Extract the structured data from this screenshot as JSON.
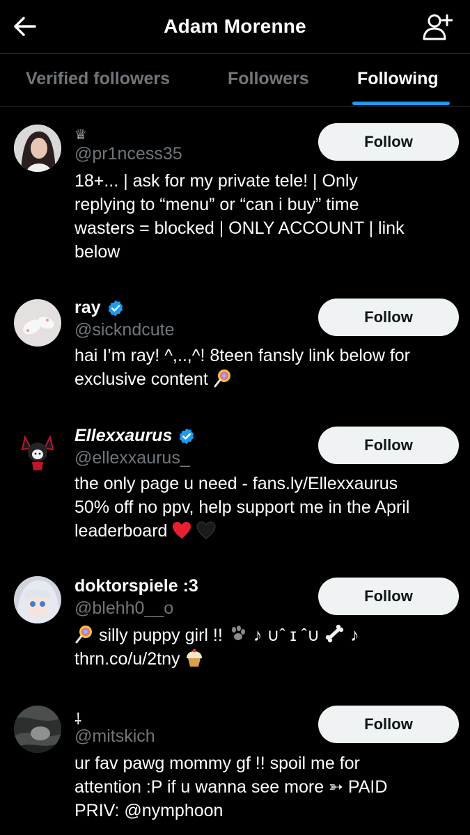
{
  "header": {
    "title": "Adam Morenne",
    "back_icon": "arrow-left-icon",
    "add_icon": "person-add-icon"
  },
  "tabs": [
    {
      "label": "Verified followers",
      "active": false
    },
    {
      "label": "Followers",
      "active": false
    },
    {
      "label": "Following",
      "active": true
    }
  ],
  "colors": {
    "background": "#000000",
    "accent": "#1d9bf0",
    "secondary_text": "#71767b",
    "button_bg": "#eff3f4"
  },
  "users": [
    {
      "name": "♕",
      "handle": "@pr1ncess35",
      "verified": false,
      "follow_label": "Follow",
      "bio_lines": [
        "18+... | ask for my private tele! | Only",
        "replying to “menu” or “can i buy” time",
        "wasters = blocked | ONLY ACCOUNT | link",
        "below"
      ]
    },
    {
      "name": "ray",
      "handle": "@sickndcute",
      "verified": true,
      "follow_label": "Follow",
      "bio_lines": [
        "hai I’m ray! ^,..,^! 8teen fansly link below for",
        "exclusive content"
      ]
    },
    {
      "name": "Ellexxaurus",
      "handle": "@ellexxaurus_",
      "verified": true,
      "follow_label": "Follow",
      "bio_lines": [
        "the only page u need - fans.ly/Ellexxaurus",
        "50% off no ppv, help support me in the April",
        "leaderboard"
      ]
    },
    {
      "name": "doktorspiele :3",
      "handle": "@blehh0__o",
      "verified": false,
      "follow_label": "Follow",
      "bio_lines": [
        "silly puppy girl !!",
        "♪ ∪ˆ ɪ ˆ∪",
        "♪",
        "thrn.co/u/2tny"
      ]
    },
    {
      "name": "⸸",
      "handle": "@mitskich",
      "verified": false,
      "follow_label": "Follow",
      "bio_lines": [
        "ur fav pawg mommy gf !! spoil me for",
        "attention :P if u wanna see more ➳ PAID",
        "PRIV: @nymphoon"
      ]
    }
  ]
}
